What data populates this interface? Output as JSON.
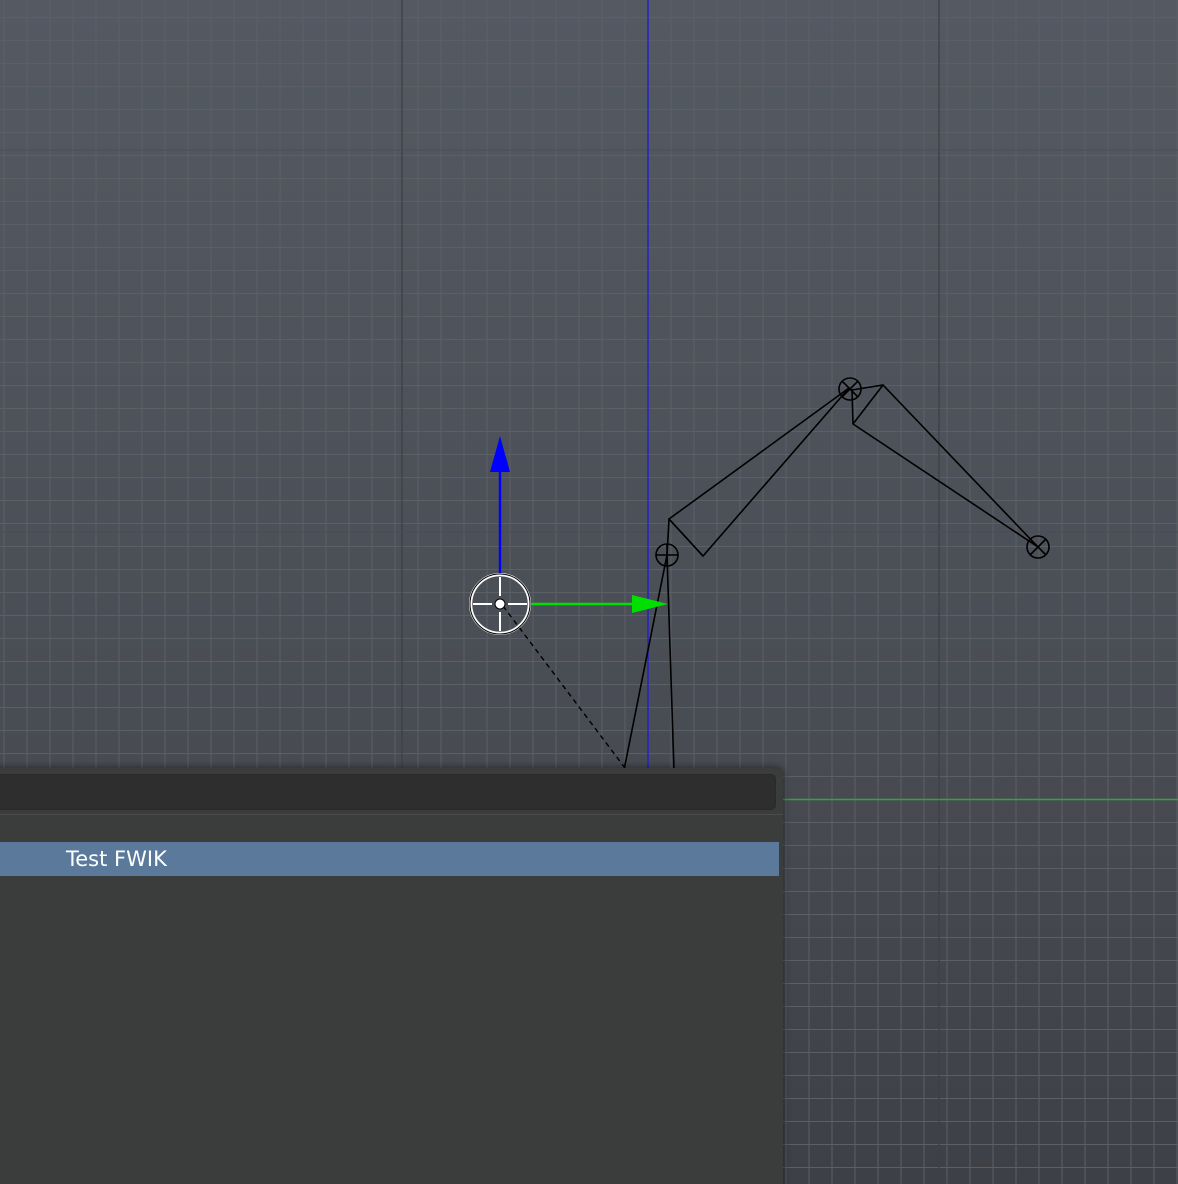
{
  "search": {
    "query": "",
    "results": [
      {
        "label": "Test FWIK",
        "active": true
      }
    ]
  },
  "colors": {
    "grid": "#5e6168",
    "axis_y": "#2222cc",
    "axis_x": "#2fa82f",
    "gizmo_z": "#0000ff",
    "gizmo_y": "#00e000",
    "highlight": "#5b7a9b",
    "panel": "#3b3d3c"
  },
  "icons": [
    "3d-cursor-icon",
    "translate-gizmo-icon",
    "bone-joint-icon"
  ]
}
